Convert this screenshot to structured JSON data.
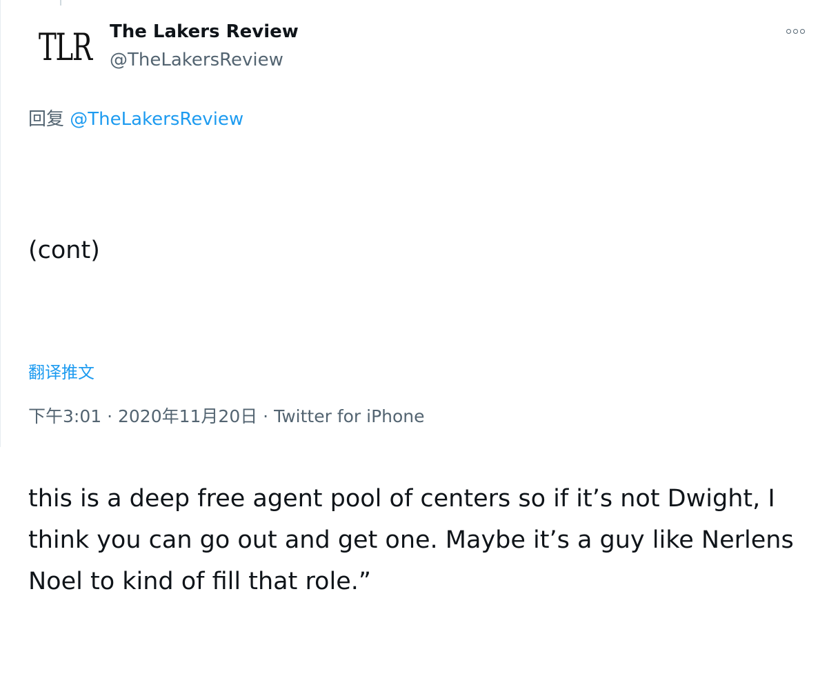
{
  "author": {
    "avatar_text": "TLR",
    "display_name": "The Lakers Review",
    "handle": "@TheLakersReview"
  },
  "more_icon": "more-options-icon",
  "reply": {
    "prefix": "回复",
    "handle": "@TheLakersReview"
  },
  "tweet": {
    "paragraph_1": "(cont)",
    "paragraph_2": "this is a deep free agent pool of centers so if it’s not Dwight, I think you can go out and get one. Maybe it’s a guy like Nerlens Noel to kind of fill that role.”"
  },
  "translate_label": "翻译推文",
  "meta": {
    "time": "下午3:01",
    "separator_1": " · ",
    "date": "2020年11月20日",
    "separator_2": " · ",
    "source": "Twitter for iPhone"
  },
  "colors": {
    "link": "#1d9bf0",
    "secondary_text": "#536471",
    "primary_text": "#0f1419"
  }
}
